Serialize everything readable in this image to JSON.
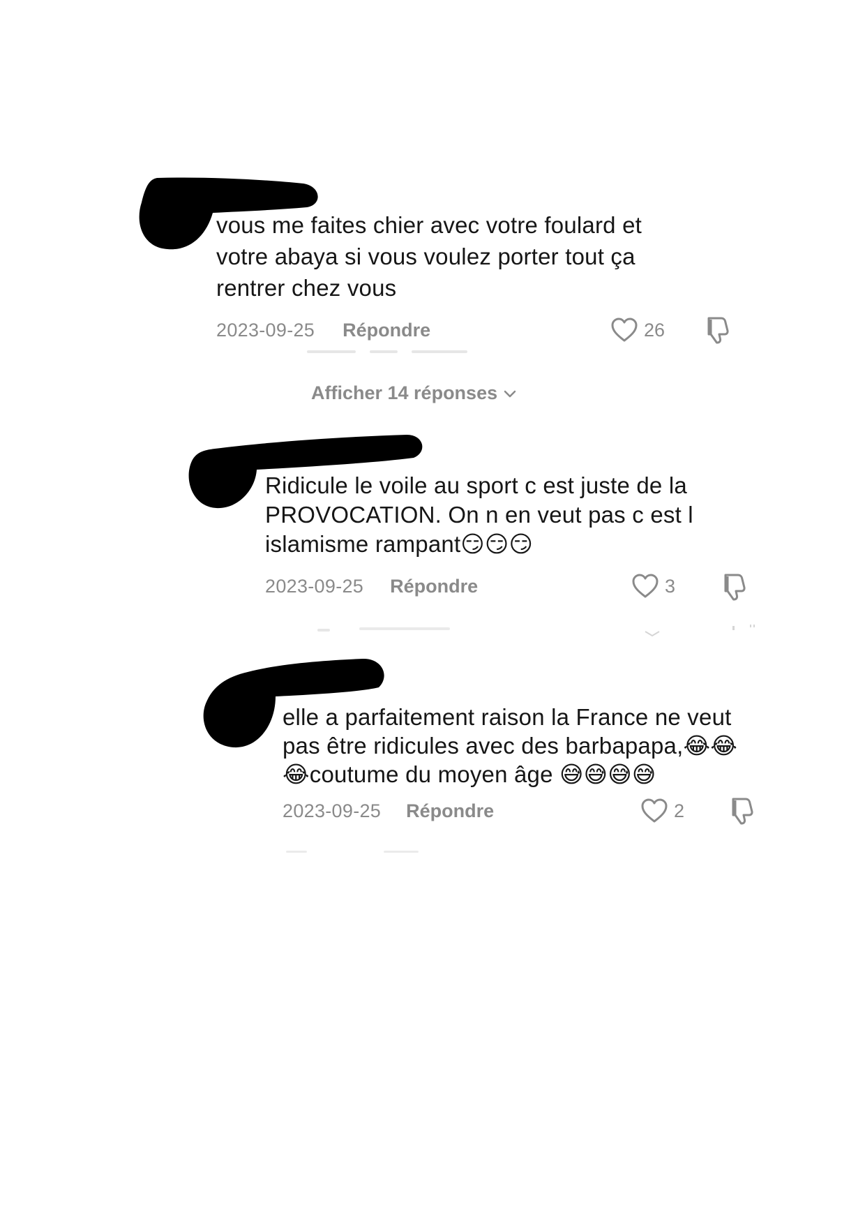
{
  "comments": [
    {
      "text": "vous me faites chier avec votre foulard et\nvotre abaya si vous voulez porter tout ça\nrentrer chez vous",
      "date": "2023-09-25",
      "reply_label": "Répondre",
      "likes": "26"
    },
    {
      "text": "Ridicule le voile au sport c est juste de la\nPROVOCATION. On n en veut pas c est l\nislamisme rampant😏😏😏",
      "date": "2023-09-25",
      "reply_label": "Répondre",
      "likes": "3"
    },
    {
      "text": "elle a parfaitement raison la France ne veut\npas être ridicules avec des barbapapa,😂😂\n😂coutume du moyen âge 😅😅😅😅",
      "date": "2023-09-25",
      "reply_label": "Répondre",
      "likes": "2"
    }
  ],
  "replies_toggle": {
    "label": "Afficher 14 réponses"
  },
  "icons": {
    "like": "heart-outline-icon",
    "dislike": "thumbs-down-icon",
    "expand": "chevron-down-icon"
  },
  "colors": {
    "text": "#161616",
    "meta": "#8a8a8a",
    "redaction": "#000000"
  }
}
